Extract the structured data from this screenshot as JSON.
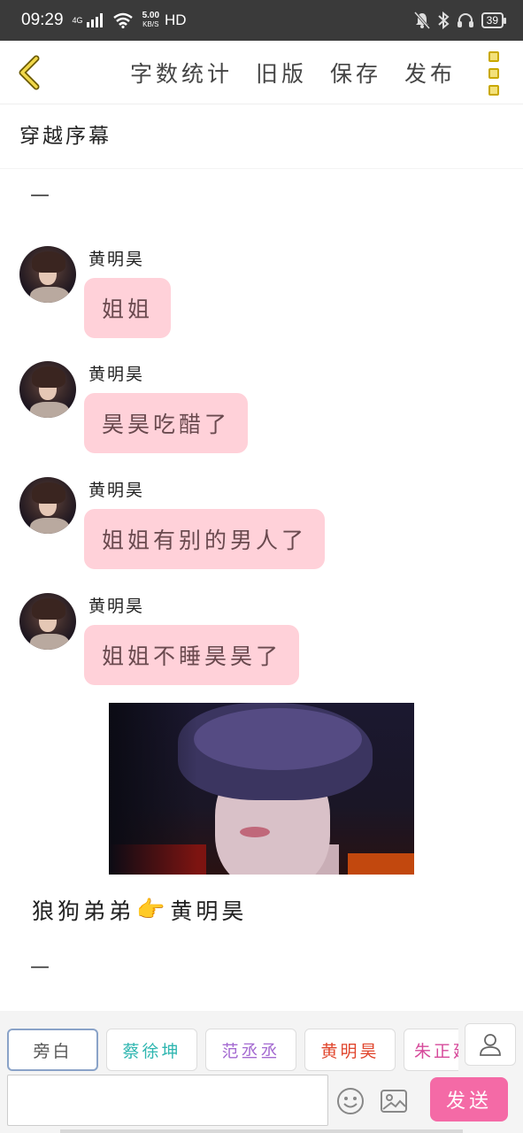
{
  "status_bar": {
    "time": "09:29",
    "net_label": "4G",
    "speed": "5.00",
    "speed_unit": "KB/S",
    "hd": "HD",
    "battery": "39"
  },
  "nav": {
    "actions": [
      "字数统计",
      "旧版",
      "保存",
      "发布"
    ],
    "back_icon": "chevron-left-icon",
    "more_icon": "more-vertical-icon",
    "accent_color": "#e2c62e"
  },
  "chapter_title": "穿越序幕",
  "dash_top": "—",
  "messages": [
    {
      "sender": "黄明昊",
      "text": "姐姐"
    },
    {
      "sender": "黄明昊",
      "text": "昊昊吃醋了"
    },
    {
      "sender": "黄明昊",
      "text": "姐姐有别的男人了"
    },
    {
      "sender": "黄明昊",
      "text": "姐姐不睡昊昊了"
    }
  ],
  "narration": {
    "before": "狼狗弟弟",
    "emoji": "👉",
    "after": "黄明昊"
  },
  "dash_bottom": "—",
  "roles": [
    {
      "label": "旁白",
      "color": "#555555"
    },
    {
      "label": "蔡徐坤",
      "color": "#2fb6b0"
    },
    {
      "label": "范丞丞",
      "color": "#a46ad1"
    },
    {
      "label": "黄明昊",
      "color": "#e0452c"
    },
    {
      "label": "朱正廷",
      "color": "#d6499a"
    }
  ],
  "input": {
    "placeholder": ""
  },
  "send_label": "发送",
  "colors": {
    "bubble": "#ffd1d9",
    "send": "#f46aa6"
  }
}
